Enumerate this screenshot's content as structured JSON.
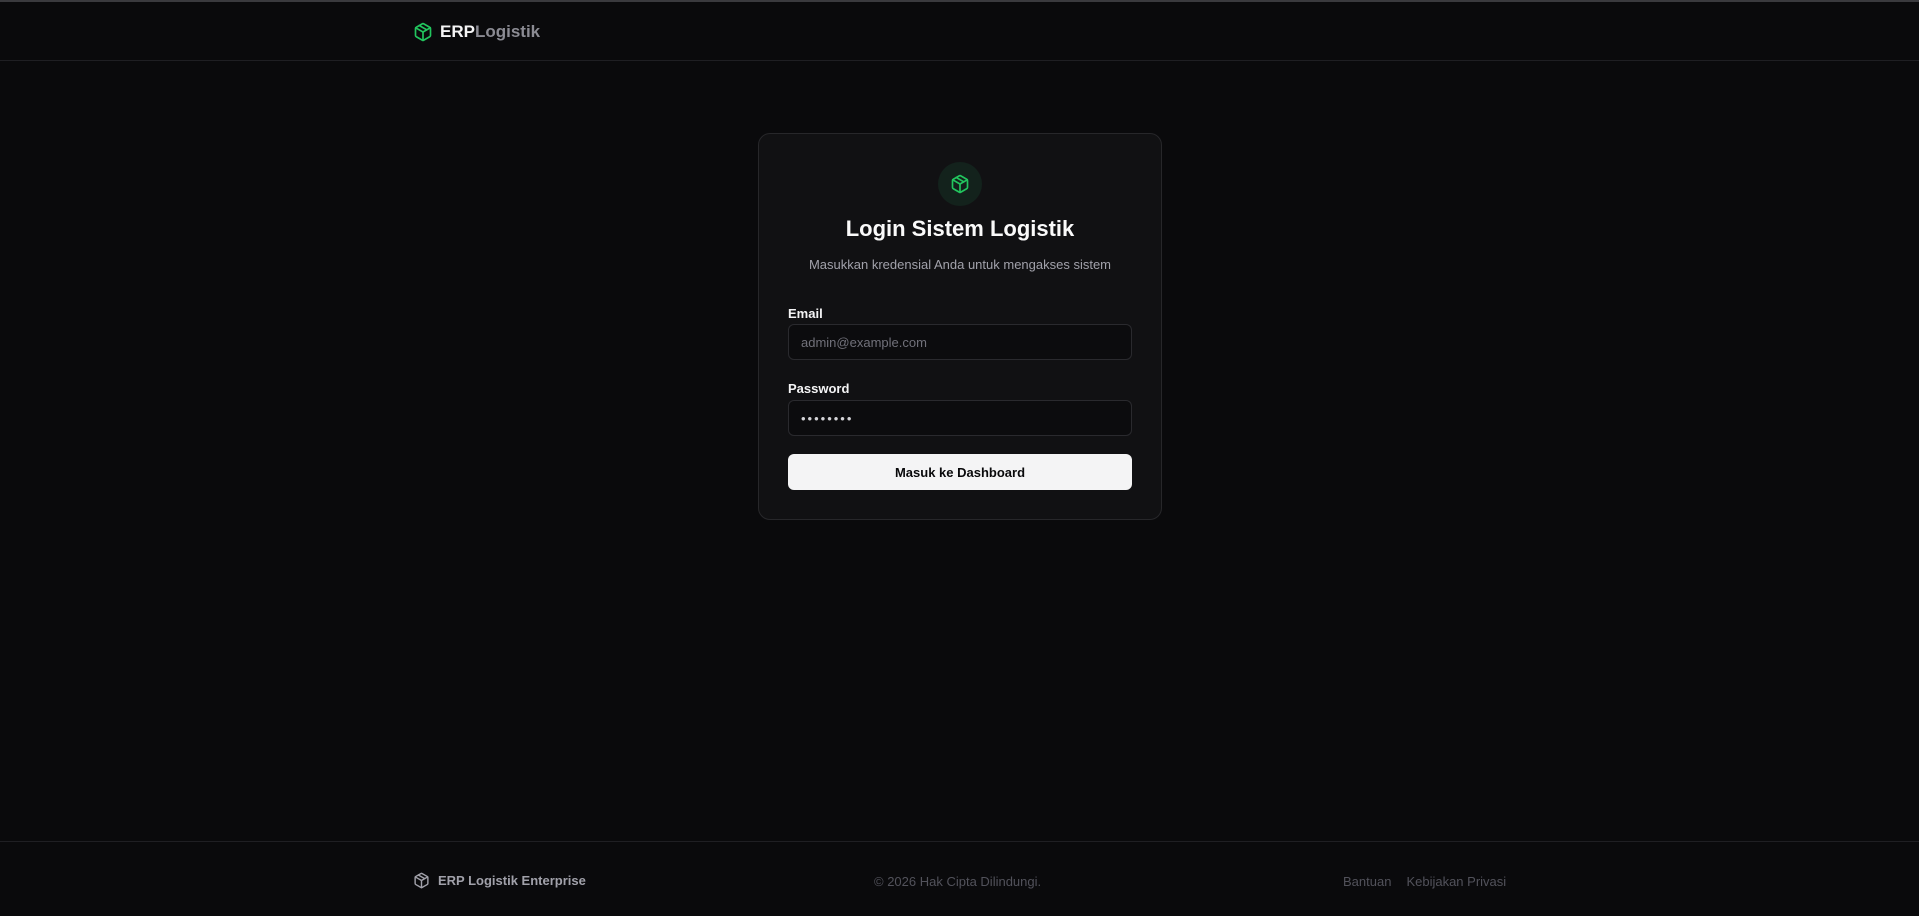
{
  "header": {
    "brand_primary": "ERP",
    "brand_secondary": "Logistik",
    "logo_icon": "package-icon"
  },
  "login": {
    "icon": "package-icon",
    "title": "Login Sistem Logistik",
    "subtitle": "Masukkan kredensial Anda untuk mengakses sistem",
    "email_label": "Email",
    "email_placeholder": "admin@example.com",
    "email_value": "",
    "password_label": "Password",
    "password_value": "12345678",
    "submit_label": "Masuk ke Dashboard"
  },
  "footer": {
    "brand": "ERP Logistik Enterprise",
    "copyright": "© 2026 Hak Cipta Dilindungi.",
    "links": [
      "Bantuan",
      "Kebijakan Privasi"
    ]
  },
  "colors": {
    "background": "#0a0a0c",
    "card": "#111113",
    "accent": "#22c55e",
    "button": "#f4f4f5"
  }
}
